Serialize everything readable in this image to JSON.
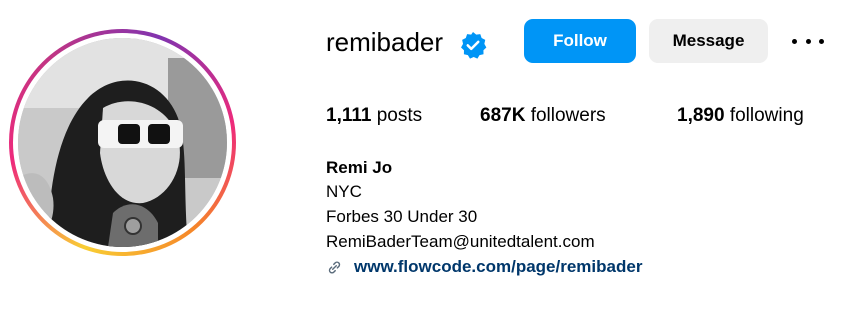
{
  "profile": {
    "username": "remibader",
    "verified": true,
    "follow_label": "Follow",
    "message_label": "Message",
    "more_icon": "more-horizontal-icon",
    "stats": {
      "posts_count": "1,111",
      "posts_label": "posts",
      "followers_count": "687K",
      "followers_label": "followers",
      "following_count": "1,890",
      "following_label": "following"
    },
    "bio": {
      "name": "Remi Jo",
      "lines": [
        "NYC",
        "Forbes 30 Under 30",
        "RemiBaderTeam@unitedtalent.com"
      ],
      "link_icon": "link-icon",
      "link_text": "www.flowcode.com/page/remibader"
    }
  },
  "colors": {
    "follow_bg": "#0095f6",
    "message_bg": "#efefef",
    "verified_badge": "#0095f6",
    "link_text": "#00376b"
  }
}
